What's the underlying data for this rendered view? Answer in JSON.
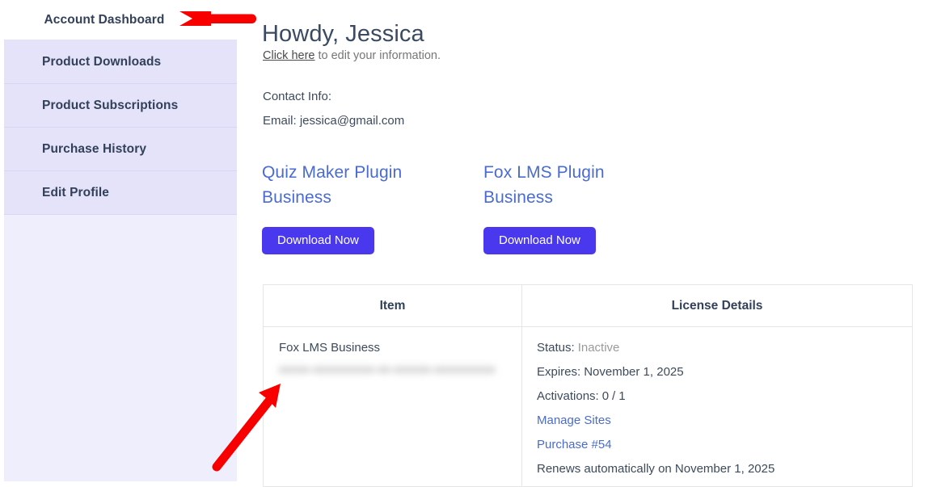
{
  "sidebar": {
    "top_item": {
      "label": "Account Dashboard"
    },
    "items": [
      {
        "label": "Product Downloads"
      },
      {
        "label": "Product Subscriptions"
      },
      {
        "label": "Purchase History"
      },
      {
        "label": "Edit Profile"
      }
    ]
  },
  "main": {
    "greeting": "Howdy, Jessica",
    "edit_link": "Click here",
    "edit_suffix": " to edit your information.",
    "contact_label": "Contact Info:",
    "contact_email": "Email: jessica@gmail.com",
    "products": [
      {
        "title": "Quiz Maker Plugin Business",
        "button": "Download Now"
      },
      {
        "title": "Fox LMS Plugin Business",
        "button": "Download Now"
      }
    ],
    "table": {
      "headers": [
        "Item",
        "License Details"
      ],
      "rows": [
        {
          "item_name": "Fox LMS Business",
          "license_key_redacted": "xxxxx-xxxxxxxxxx-xx-xxxxxx-xxxxxxxxxx",
          "status_label": "Status:",
          "status_value": "Inactive",
          "expires_label": "Expires:",
          "expires_value": "November 1, 2025",
          "activations_label": "Activations:",
          "activations_used": "0",
          "activations_separator": "/",
          "activations_total": "1",
          "manage_sites_link": "Manage Sites",
          "purchase_link": "Purchase #54",
          "renews_text": "Renews automatically on November 1, 2025"
        }
      ]
    }
  },
  "annotations": {
    "arrow_color": "#f90000",
    "arrows": [
      {
        "name": "arrow-pointing-to-account-dashboard",
        "direction": "left"
      },
      {
        "name": "arrow-pointing-to-license-key",
        "direction": "up-right"
      }
    ]
  },
  "colors": {
    "accent_button": "#4a38ef",
    "link_blue": "#4a6bcf",
    "sidebar_item_bg": "#e4e3fa",
    "sidebar_panel_bg": "#eeeefc",
    "heading_text": "#394a61"
  }
}
